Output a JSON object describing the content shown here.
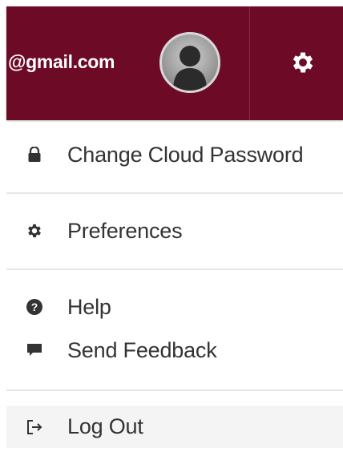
{
  "header": {
    "email": "@gmail.com",
    "background": "#6d0b27",
    "avatar_icon": "user-avatar-icon",
    "settings_icon": "gear-icon"
  },
  "menu": {
    "items": [
      {
        "label": "Change Cloud Password",
        "icon": "lock-icon"
      },
      {
        "label": "Preferences",
        "icon": "gear-icon"
      },
      {
        "label": "Help",
        "icon": "question-circle-icon"
      },
      {
        "label": "Send Feedback",
        "icon": "comment-icon"
      },
      {
        "label": "Log Out",
        "icon": "sign-out-icon"
      }
    ]
  }
}
